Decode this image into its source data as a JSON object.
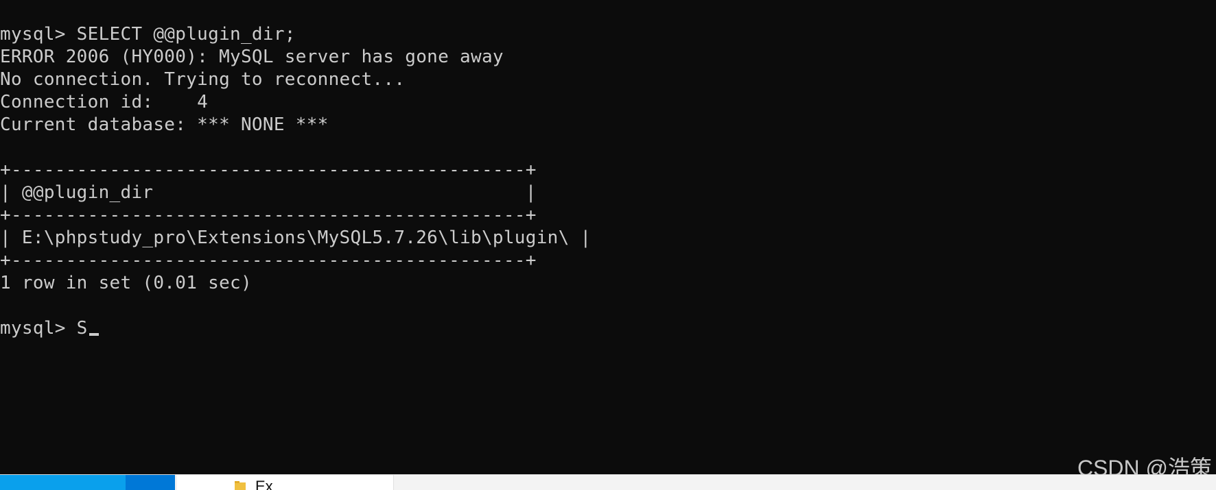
{
  "terminal": {
    "lines": [
      "mysql> SELECT @@plugin_dir;",
      "ERROR 2006 (HY000): MySQL server has gone away",
      "No connection. Trying to reconnect...",
      "Connection id:    4",
      "Current database: *** NONE ***",
      "",
      "+-----------------------------------------------+",
      "| @@plugin_dir                                  |",
      "+-----------------------------------------------+",
      "| E:\\phpstudy_pro\\Extensions\\MySQL5.7.26\\lib\\plugin\\ |",
      "+-----------------------------------------------+",
      "1 row in set (0.01 sec)",
      "",
      "mysql> S"
    ],
    "text_color": "#cccccc",
    "background_color": "#0c0c0c"
  },
  "watermark": {
    "text": "CSDN @浩策"
  },
  "taskbar": {
    "explorer_label": "Ex",
    "folder_icon": "folder-icon",
    "accent_colors": [
      "#0aa0ec",
      "#0078d7"
    ]
  }
}
